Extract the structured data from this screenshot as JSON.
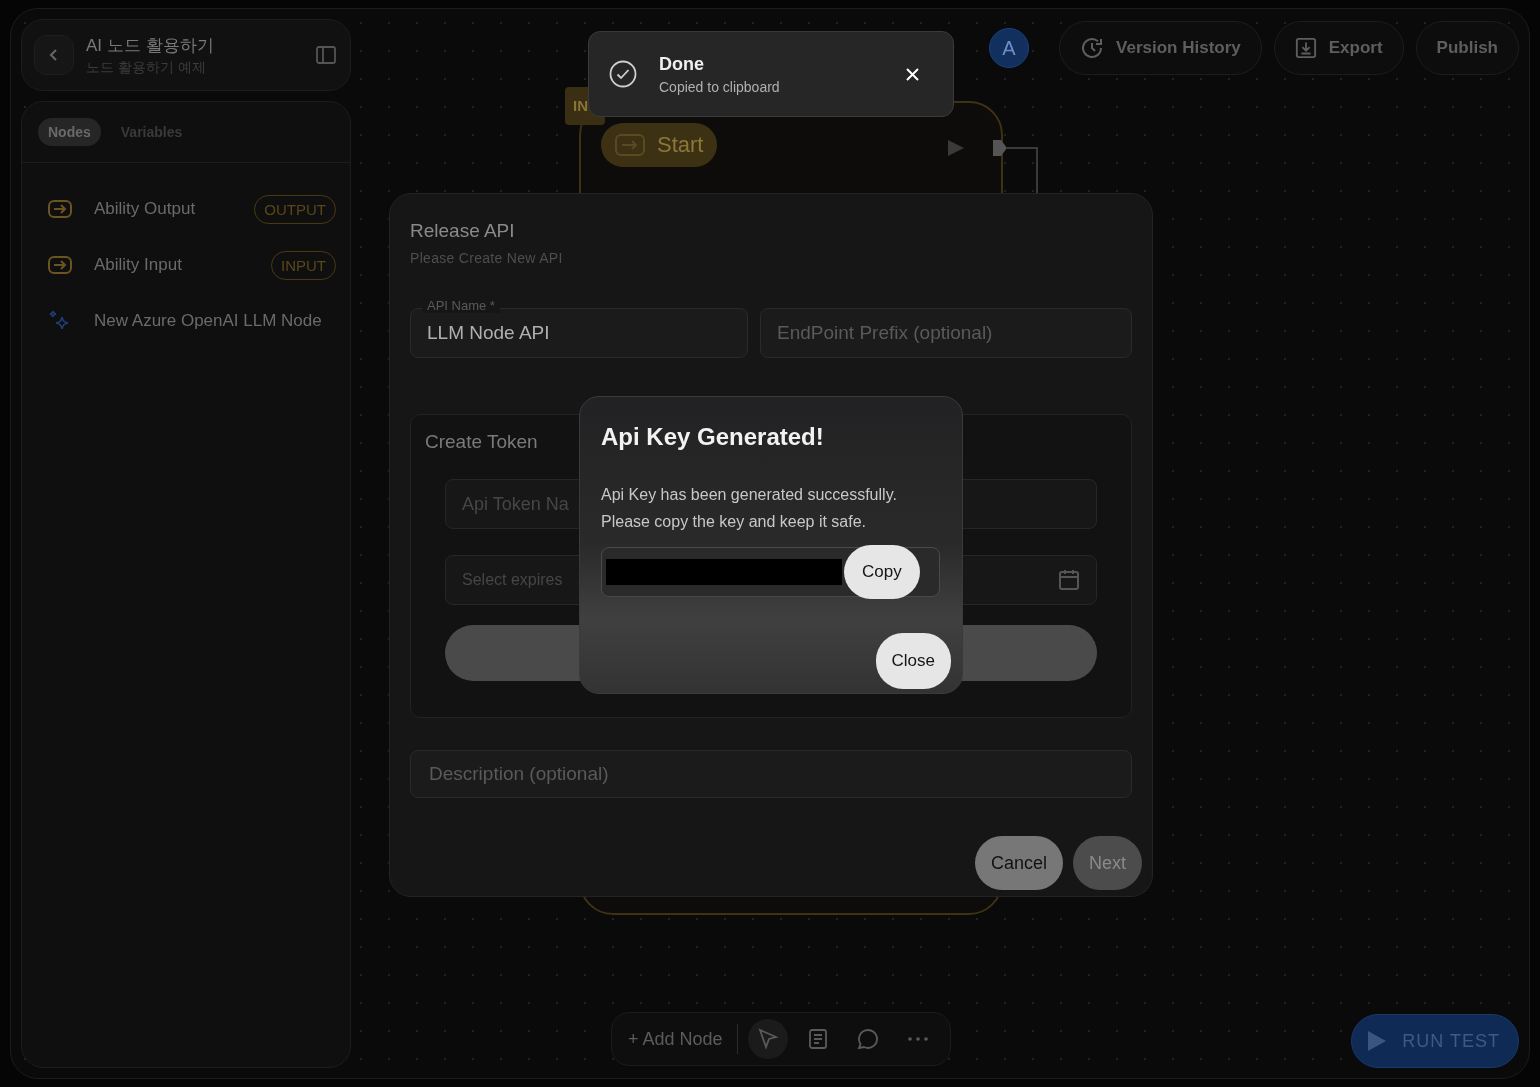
{
  "project": {
    "title": "AI 노드 활용하기",
    "subtitle": "노드 활용하기 예제"
  },
  "sidebar": {
    "tabs": [
      {
        "label": "Nodes",
        "selected": true
      },
      {
        "label": "Variables",
        "selected": false
      }
    ],
    "items": [
      {
        "label": "Ability Output",
        "kind": "io",
        "badge": "OUTPUT"
      },
      {
        "label": "Ability Input",
        "kind": "io",
        "badge": "INPUT"
      },
      {
        "label": "New Azure OpenAI LLM Node",
        "kind": "llm"
      }
    ]
  },
  "header": {
    "avatar": "A",
    "buttons": [
      {
        "label": "Version History",
        "kind": "history"
      },
      {
        "label": "Export",
        "kind": "export"
      },
      {
        "label": "Publish",
        "kind": "plain"
      }
    ]
  },
  "canvas": {
    "node": {
      "tag": "IN",
      "title": "Start"
    }
  },
  "toolbar": {
    "add_label": "+ Add Node",
    "tools": [
      {
        "kind": "pointer",
        "selected": true
      },
      {
        "kind": "note",
        "selected": false
      },
      {
        "kind": "comment",
        "selected": false
      },
      {
        "kind": "more",
        "selected": false
      }
    ]
  },
  "run_button": "RUN TEST",
  "release_dialog": {
    "title": "Release API",
    "subtitle": "Please Create New API",
    "name_field": {
      "label": "API Name *",
      "value": "LLM Node API"
    },
    "prefix_field": {
      "placeholder": "EndPoint Prefix (optional)"
    },
    "token": {
      "title": "Create Token",
      "name_placeholder": "Api Token Na",
      "expiry_placeholder": "Select expires"
    },
    "description_placeholder": "Description (optional)",
    "buttons": [
      {
        "label": "Cancel",
        "disabled": false
      },
      {
        "label": "Next",
        "disabled": true
      }
    ]
  },
  "key_dialog": {
    "title": "Api Key Generated!",
    "message": "Api Key has been generated successfully. Please copy the key and keep it safe.",
    "copy_label": "Copy",
    "close_label": "Close"
  },
  "toast": {
    "title": "Done",
    "message": "Copied to clipboard"
  }
}
